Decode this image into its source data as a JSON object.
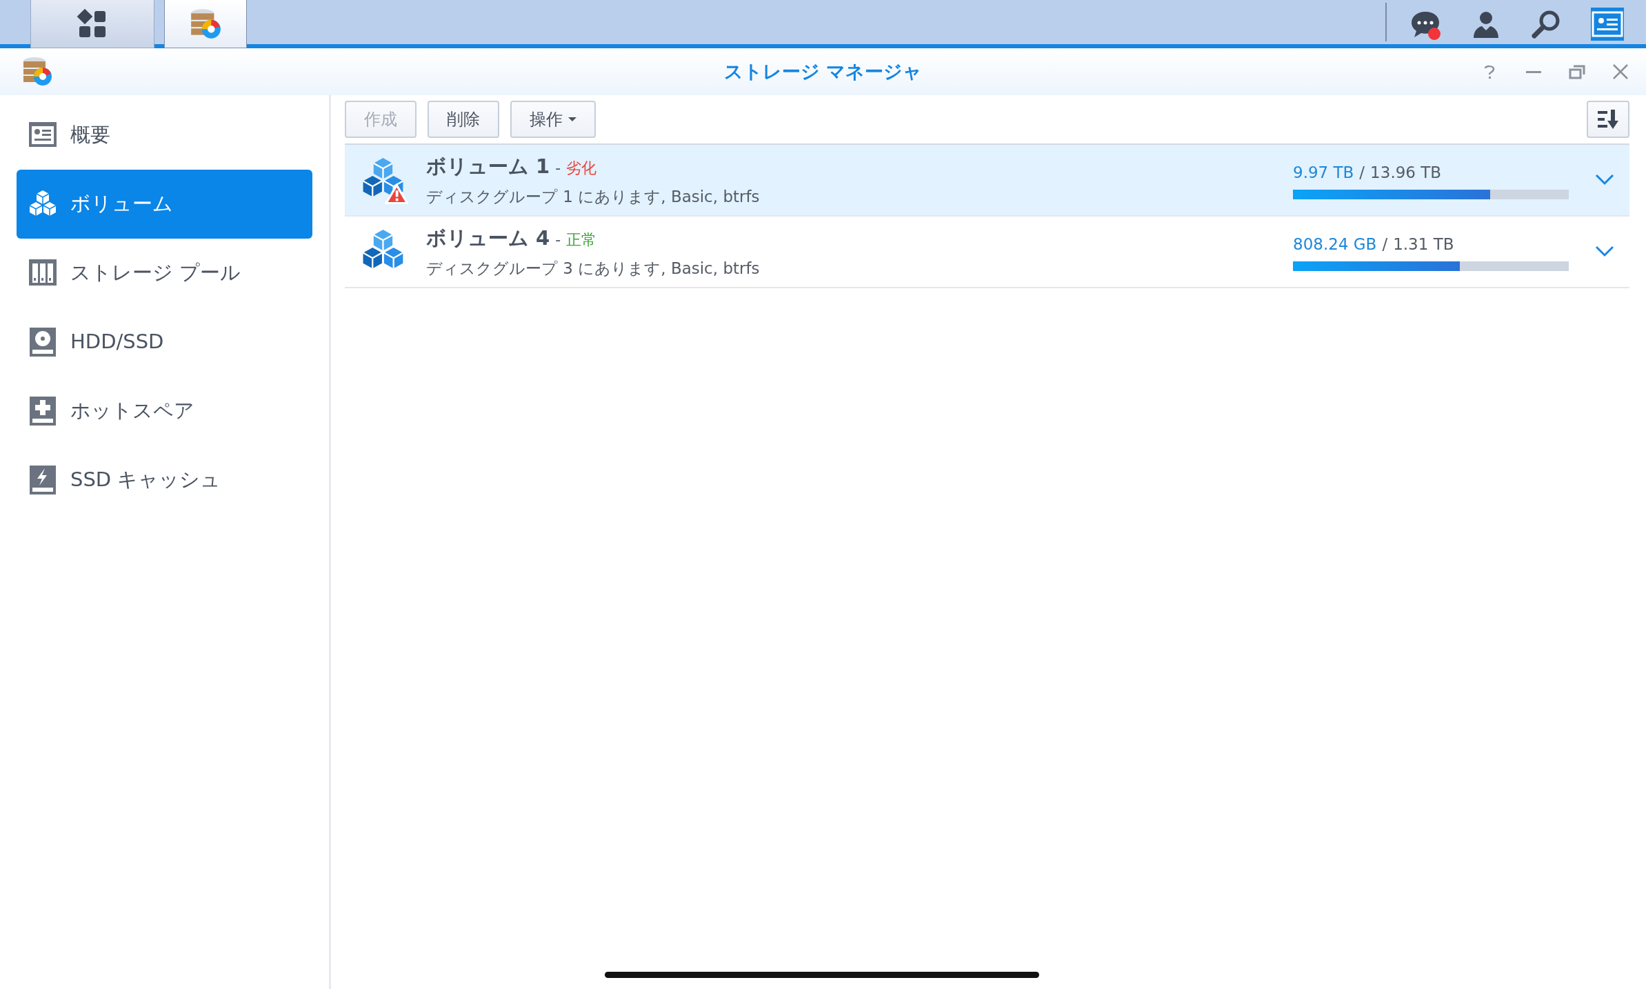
{
  "taskbar": {
    "apps": [
      {
        "selected": false
      },
      {
        "selected": true
      }
    ],
    "tray": [
      {
        "selected": false,
        "notification": true
      },
      {
        "selected": false,
        "notification": false
      },
      {
        "selected": false,
        "notification": false
      },
      {
        "selected": true,
        "notification": false
      }
    ]
  },
  "window": {
    "title": "ストレージ マネージャ"
  },
  "sidebar": {
    "items": [
      {
        "label": "概要",
        "selected": false
      },
      {
        "label": "ボリューム",
        "selected": true
      },
      {
        "label": "ストレージ プール",
        "selected": false
      },
      {
        "label": "HDD/SSD",
        "selected": false
      },
      {
        "label": "ホットスペア",
        "selected": false
      },
      {
        "label": "SSD キャッシュ",
        "selected": false
      }
    ]
  },
  "toolbar": {
    "buttons": [
      {
        "label": "作成",
        "disabled": true,
        "kind": "plain"
      },
      {
        "label": "削除",
        "disabled": false,
        "kind": "plain"
      },
      {
        "label": "操作",
        "disabled": false,
        "kind": "dropdown"
      }
    ]
  },
  "volumes": [
    {
      "name": "ボリューム 1",
      "status": "劣化",
      "kind": "degraded",
      "separator": "-",
      "slash": "/",
      "location": "ディスクグループ 1 にあります, Basic, btrfs",
      "used": "9.97 TB",
      "total": "13.96 TB",
      "level": 0.715,
      "selected": true
    },
    {
      "name": "ボリューム 4",
      "status": "正常",
      "kind": "normal",
      "separator": "-",
      "slash": "/",
      "location": "ディスクグループ 3 にあります, Basic, btrfs",
      "used": "808.24 GB",
      "total": "1.31 TB",
      "level": 0.605,
      "selected": false
    }
  ]
}
